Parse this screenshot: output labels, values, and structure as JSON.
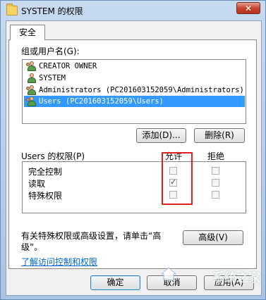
{
  "window": {
    "title": "SYSTEM 的权限",
    "close_label": "✕"
  },
  "tab": {
    "label": "安全"
  },
  "groups": {
    "label": "组或用户名(G):",
    "items": [
      {
        "name": "CREATOR OWNER",
        "selected": false
      },
      {
        "name": "SYSTEM",
        "selected": false
      },
      {
        "name": "Administrators (PC201603152059\\Administrators)",
        "selected": false
      },
      {
        "name": "Users (PC201603152059\\Users)",
        "selected": true
      }
    ]
  },
  "buttons": {
    "add": "添加(D)...",
    "remove": "删除(R)",
    "advanced": "高级(V)",
    "ok": "确定",
    "cancel": "取消",
    "apply": "应用(A)"
  },
  "permissions": {
    "label": "Users 的权限(P)",
    "allow_header": "允许",
    "deny_header": "拒绝",
    "rows": [
      {
        "name": "完全控制",
        "allow": false,
        "deny": false
      },
      {
        "name": "读取",
        "allow": true,
        "deny": false
      },
      {
        "name": "特殊权限",
        "allow": false,
        "deny": false
      }
    ]
  },
  "advanced_text": {
    "line1": "有关特殊权限或高级设置，请单击“高",
    "line2": "级”。"
  },
  "learn_link": "了解访问控制和权限",
  "watermark": "系统之家"
}
